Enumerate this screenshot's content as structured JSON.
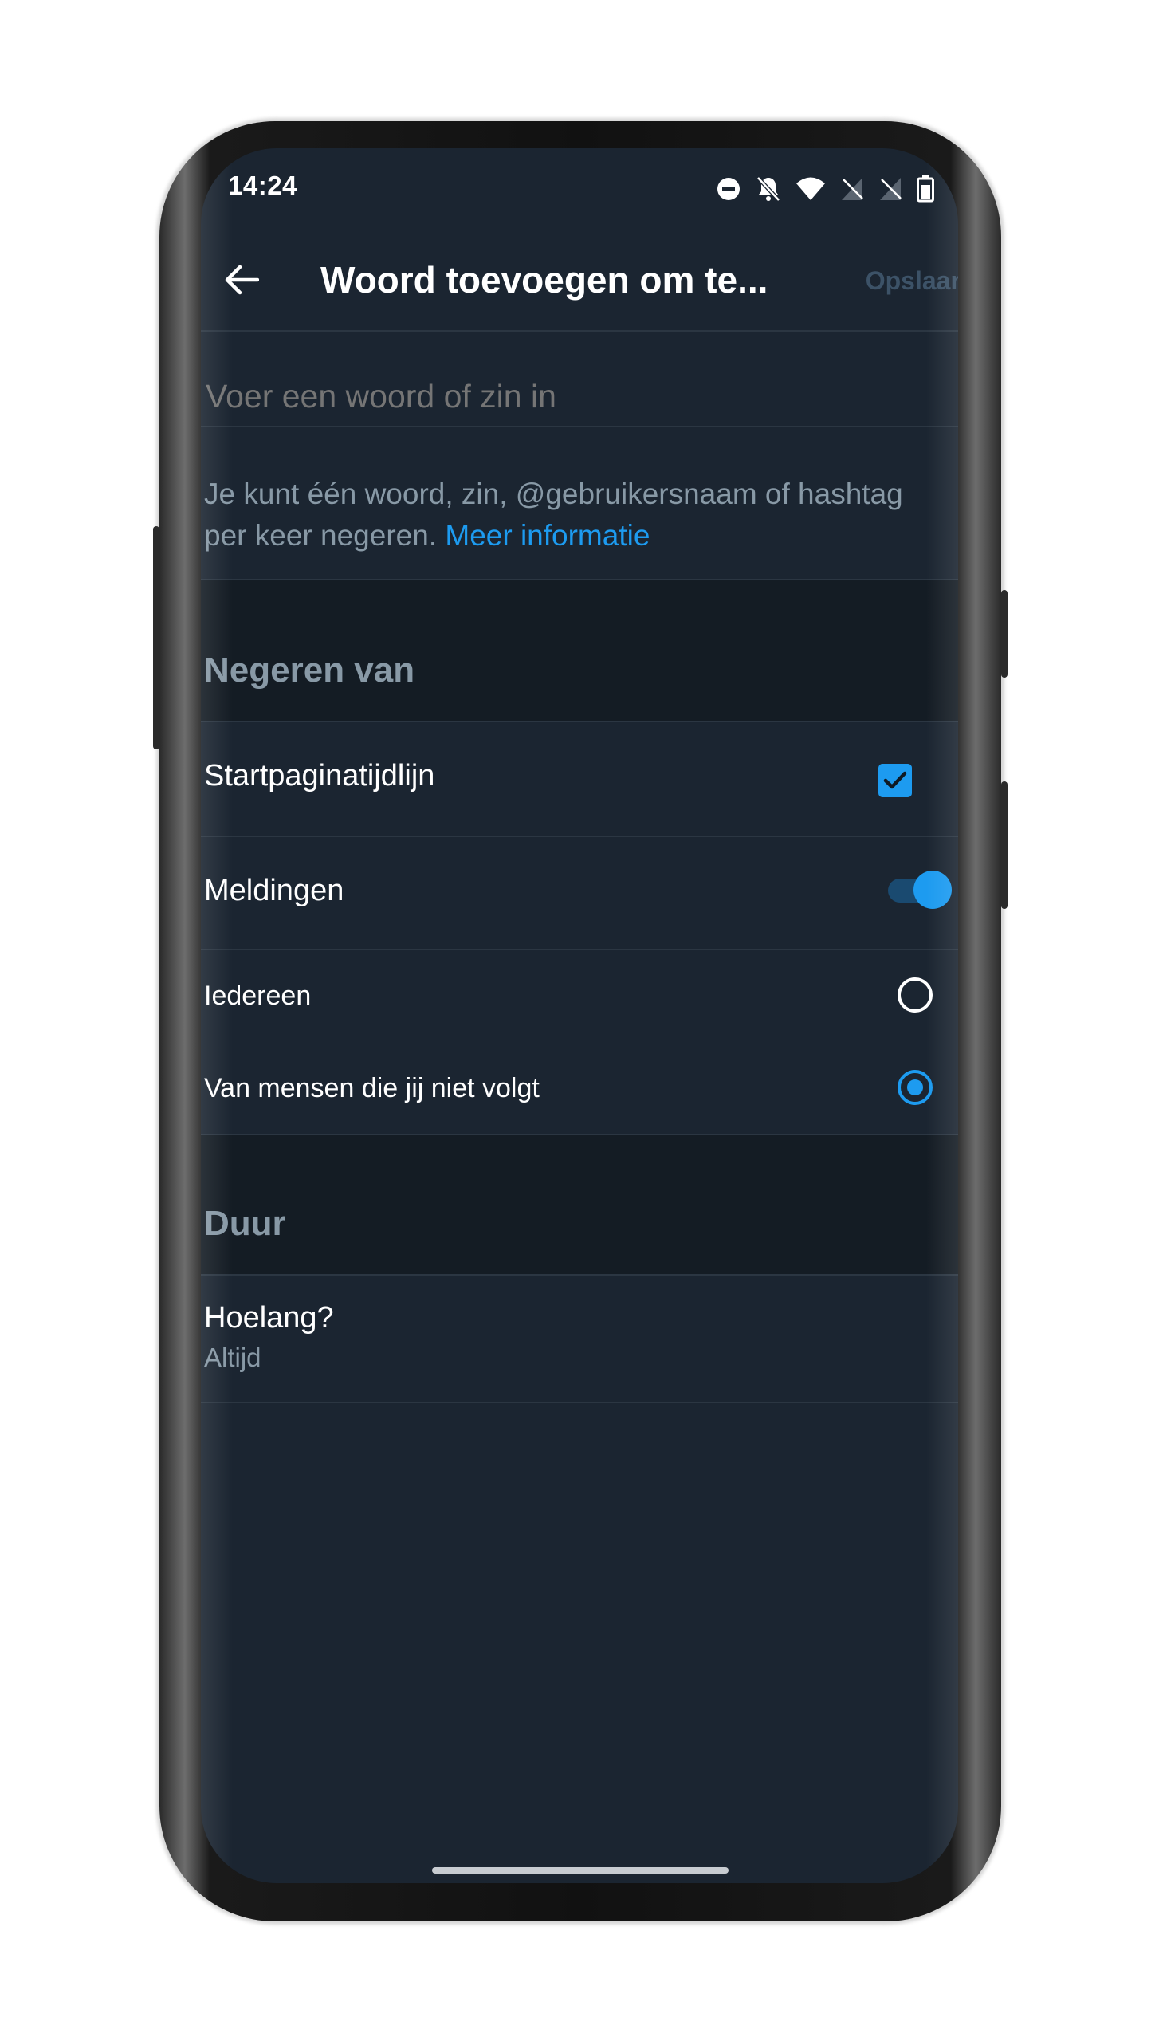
{
  "status_bar": {
    "time": "14:24",
    "icons": [
      "dnd-icon",
      "bell-off-icon",
      "wifi-icon",
      "no-signal-icon",
      "no-signal-icon",
      "battery-icon"
    ]
  },
  "app_bar": {
    "back_icon": "arrow-left-icon",
    "title": "Woord toevoegen om te...",
    "save_label": "Opslaan"
  },
  "input": {
    "placeholder": "Voer een woord of zin in",
    "value": ""
  },
  "help": {
    "text": "Je kunt één woord, zin, @gebruikersnaam of hashtag per keer negeren.",
    "link": "Meer informatie"
  },
  "mute_from": {
    "section_title": "Negeren van",
    "home_timeline": {
      "label": "Startpaginatijdlijn",
      "checked": true
    },
    "notifications": {
      "label": "Meldingen",
      "enabled": true
    },
    "options": [
      {
        "label": "Iedereen",
        "selected": false
      },
      {
        "label": "Van mensen die jij niet volgt",
        "selected": true
      }
    ]
  },
  "duration": {
    "section_title": "Duur",
    "label": "Hoelang?",
    "value": "Altijd"
  },
  "colors": {
    "background": "#1b2531",
    "section_background": "#141c24",
    "accent": "#1d9bf0",
    "secondary_text": "#8899a6"
  }
}
